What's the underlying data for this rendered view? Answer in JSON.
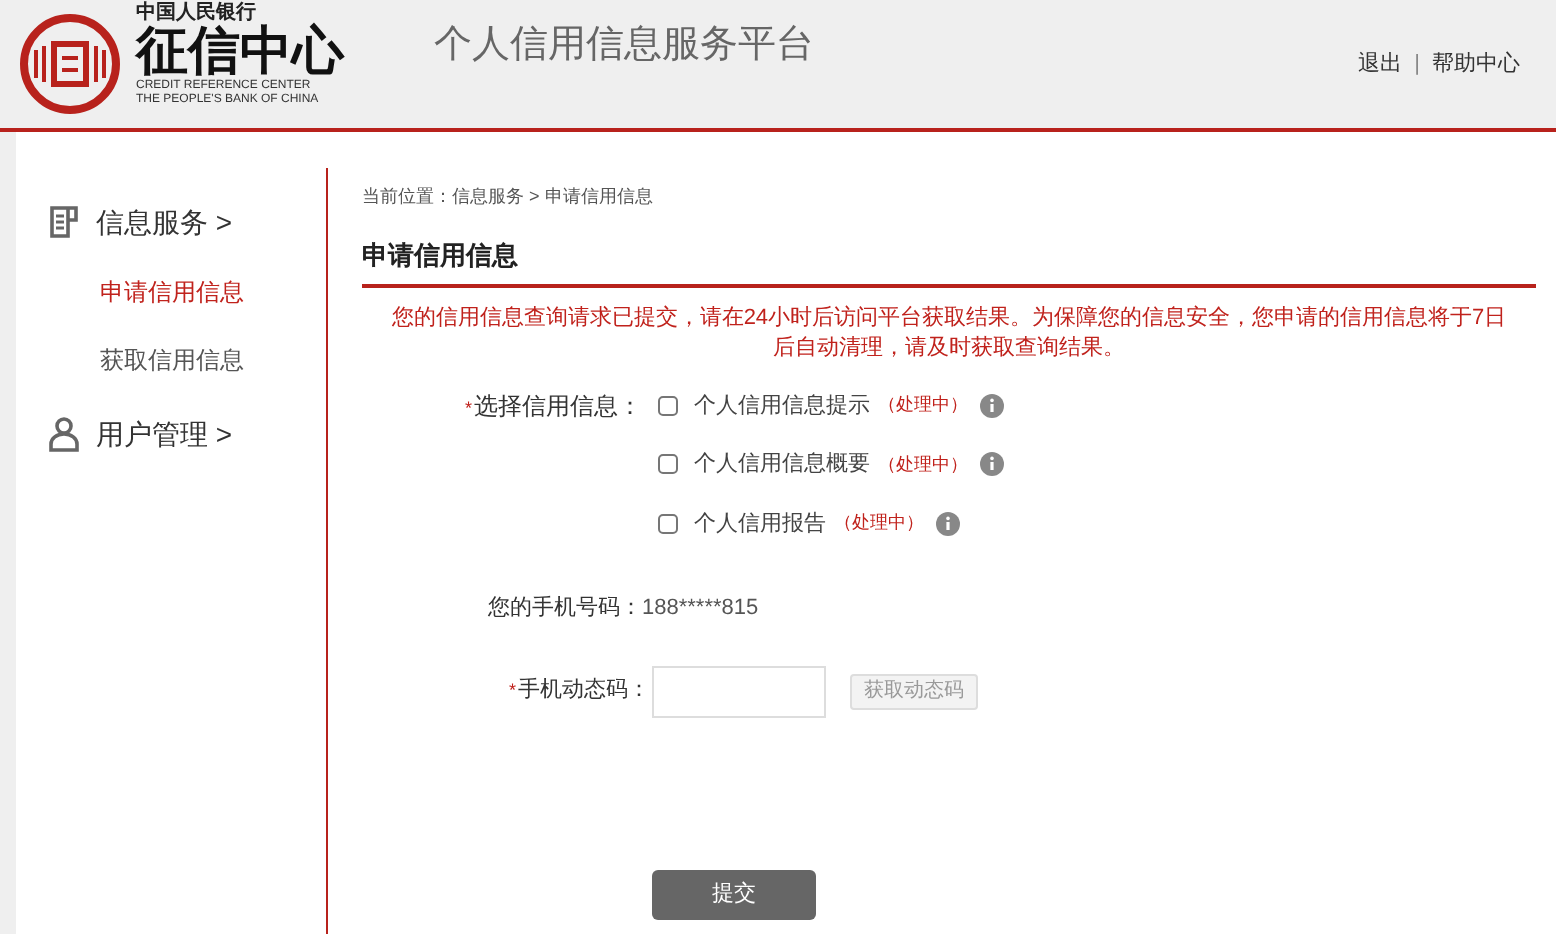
{
  "header": {
    "logo_top": "中国人民银行",
    "logo_name": "征信中心",
    "logo_en_1": "CREDIT REFERENCE CENTER",
    "logo_en_2": "THE PEOPLE'S BANK OF CHINA",
    "platform_title": "个人信用信息服务平台",
    "links": [
      "退出",
      "帮助中心"
    ],
    "separator": "|"
  },
  "sidebar": [
    {
      "kind": "group",
      "label": "信息服务 >"
    },
    {
      "kind": "item",
      "label": "申请信用信息",
      "selected": true
    },
    {
      "kind": "item",
      "label": "获取信用信息",
      "selected": false
    },
    {
      "kind": "group",
      "label": "用户管理 >"
    }
  ],
  "breadcrumb": "当前位置：信息服务 > 申请信用信息",
  "section_title": "申请信用信息",
  "notice": "您的信用信息查询请求已提交，请在24小时后访问平台获取结果。为保障您的信息安全，您申请的信用信息将于7日后自动清理，请及时获取查询结果。",
  "form": {
    "required_mark": "*",
    "select_label": "选择信用信息：",
    "options": [
      {
        "label": "个人信用信息提示",
        "status": "（处理中）",
        "checked": false
      },
      {
        "label": "个人信用信息概要",
        "status": "（处理中）",
        "checked": false
      },
      {
        "label": "个人信用报告",
        "status": "（处理中）",
        "checked": false
      }
    ],
    "phone_label": "您的手机号码：",
    "phone_value": "188*****815",
    "code_label": "手机动态码：",
    "code_button": "获取动态码",
    "submit": "提交"
  }
}
